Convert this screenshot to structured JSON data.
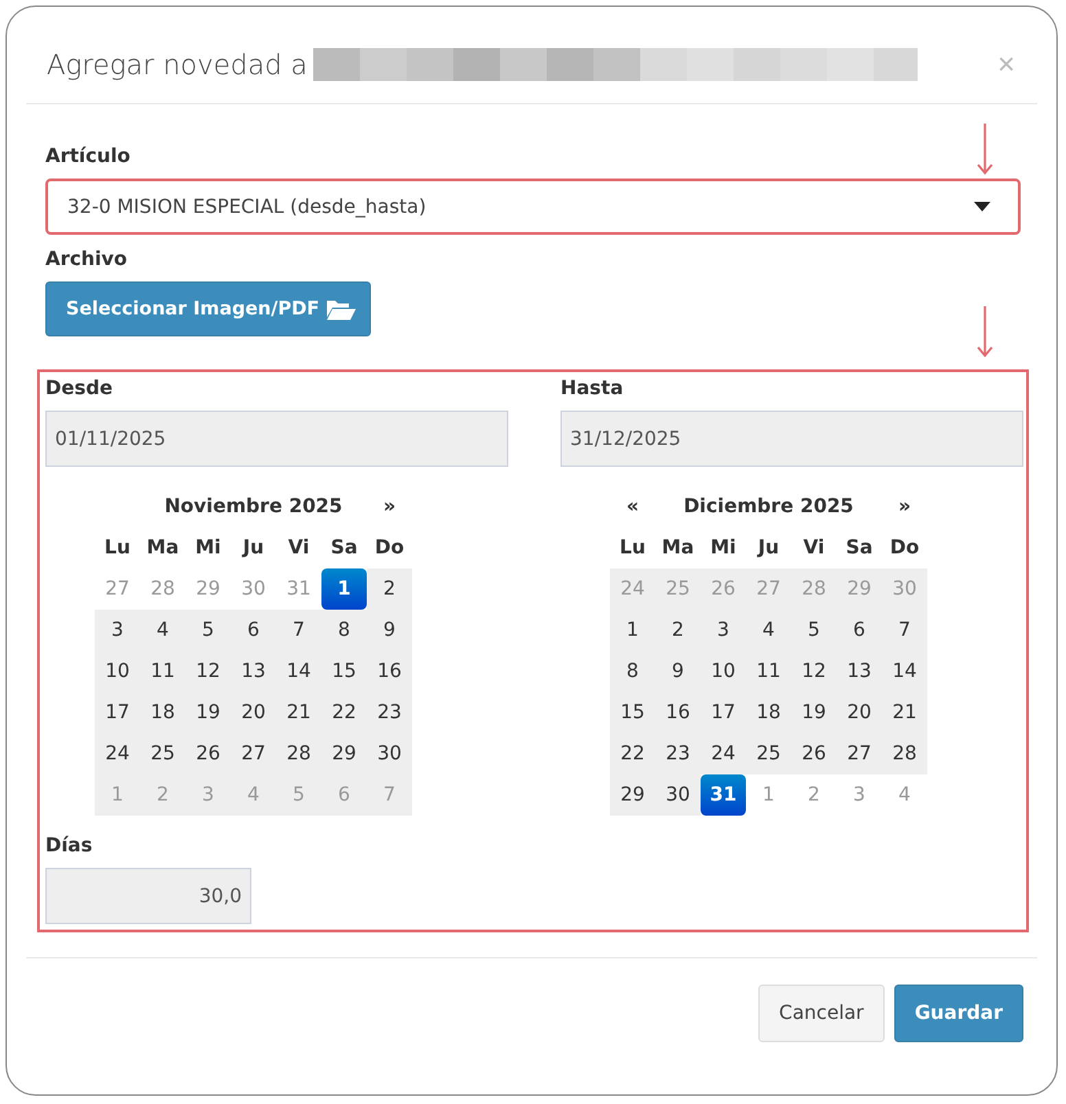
{
  "modal": {
    "title": "Agregar novedad a",
    "close": "×"
  },
  "article": {
    "label": "Artículo",
    "value": "32-0 MISION ESPECIAL (desde_hasta)",
    "highlighted": true
  },
  "file": {
    "label": "Archivo",
    "button": "Seleccionar Imagen/PDF"
  },
  "dates": {
    "highlighted": true,
    "from": {
      "label": "Desde",
      "value": "01/11/2025",
      "calendar": {
        "title": "Noviembre 2025",
        "next": "»",
        "weekdays": [
          "Lu",
          "Ma",
          "Mi",
          "Ju",
          "Vi",
          "Sa",
          "Do"
        ],
        "weeks": [
          [
            {
              "day": "27",
              "muted": true,
              "in_range": false,
              "selected": false
            },
            {
              "day": "28",
              "muted": true,
              "in_range": false,
              "selected": false
            },
            {
              "day": "29",
              "muted": true,
              "in_range": false,
              "selected": false
            },
            {
              "day": "30",
              "muted": true,
              "in_range": false,
              "selected": false
            },
            {
              "day": "31",
              "muted": true,
              "in_range": false,
              "selected": false
            },
            {
              "day": "1",
              "muted": false,
              "in_range": true,
              "selected": true
            },
            {
              "day": "2",
              "muted": false,
              "in_range": true,
              "selected": false
            }
          ],
          [
            {
              "day": "3",
              "muted": false,
              "in_range": true,
              "selected": false
            },
            {
              "day": "4",
              "muted": false,
              "in_range": true,
              "selected": false
            },
            {
              "day": "5",
              "muted": false,
              "in_range": true,
              "selected": false
            },
            {
              "day": "6",
              "muted": false,
              "in_range": true,
              "selected": false
            },
            {
              "day": "7",
              "muted": false,
              "in_range": true,
              "selected": false
            },
            {
              "day": "8",
              "muted": false,
              "in_range": true,
              "selected": false
            },
            {
              "day": "9",
              "muted": false,
              "in_range": true,
              "selected": false
            }
          ],
          [
            {
              "day": "10",
              "muted": false,
              "in_range": true,
              "selected": false
            },
            {
              "day": "11",
              "muted": false,
              "in_range": true,
              "selected": false
            },
            {
              "day": "12",
              "muted": false,
              "in_range": true,
              "selected": false
            },
            {
              "day": "13",
              "muted": false,
              "in_range": true,
              "selected": false
            },
            {
              "day": "14",
              "muted": false,
              "in_range": true,
              "selected": false
            },
            {
              "day": "15",
              "muted": false,
              "in_range": true,
              "selected": false
            },
            {
              "day": "16",
              "muted": false,
              "in_range": true,
              "selected": false
            }
          ],
          [
            {
              "day": "17",
              "muted": false,
              "in_range": true,
              "selected": false
            },
            {
              "day": "18",
              "muted": false,
              "in_range": true,
              "selected": false
            },
            {
              "day": "19",
              "muted": false,
              "in_range": true,
              "selected": false
            },
            {
              "day": "20",
              "muted": false,
              "in_range": true,
              "selected": false
            },
            {
              "day": "21",
              "muted": false,
              "in_range": true,
              "selected": false
            },
            {
              "day": "22",
              "muted": false,
              "in_range": true,
              "selected": false
            },
            {
              "day": "23",
              "muted": false,
              "in_range": true,
              "selected": false
            }
          ],
          [
            {
              "day": "24",
              "muted": false,
              "in_range": true,
              "selected": false
            },
            {
              "day": "25",
              "muted": false,
              "in_range": true,
              "selected": false
            },
            {
              "day": "26",
              "muted": false,
              "in_range": true,
              "selected": false
            },
            {
              "day": "27",
              "muted": false,
              "in_range": true,
              "selected": false
            },
            {
              "day": "28",
              "muted": false,
              "in_range": true,
              "selected": false
            },
            {
              "day": "29",
              "muted": false,
              "in_range": true,
              "selected": false
            },
            {
              "day": "30",
              "muted": false,
              "in_range": true,
              "selected": false
            }
          ],
          [
            {
              "day": "1",
              "muted": true,
              "in_range": true,
              "selected": false
            },
            {
              "day": "2",
              "muted": true,
              "in_range": true,
              "selected": false
            },
            {
              "day": "3",
              "muted": true,
              "in_range": true,
              "selected": false
            },
            {
              "day": "4",
              "muted": true,
              "in_range": true,
              "selected": false
            },
            {
              "day": "5",
              "muted": true,
              "in_range": true,
              "selected": false
            },
            {
              "day": "6",
              "muted": true,
              "in_range": true,
              "selected": false
            },
            {
              "day": "7",
              "muted": true,
              "in_range": true,
              "selected": false
            }
          ]
        ]
      }
    },
    "to": {
      "label": "Hasta",
      "value": "31/12/2025",
      "calendar": {
        "title": "Diciembre 2025",
        "prev": "«",
        "next": "»",
        "weekdays": [
          "Lu",
          "Ma",
          "Mi",
          "Ju",
          "Vi",
          "Sa",
          "Do"
        ],
        "weeks": [
          [
            {
              "day": "24",
              "muted": true,
              "in_range": true,
              "selected": false
            },
            {
              "day": "25",
              "muted": true,
              "in_range": true,
              "selected": false
            },
            {
              "day": "26",
              "muted": true,
              "in_range": true,
              "selected": false
            },
            {
              "day": "27",
              "muted": true,
              "in_range": true,
              "selected": false
            },
            {
              "day": "28",
              "muted": true,
              "in_range": true,
              "selected": false
            },
            {
              "day": "29",
              "muted": true,
              "in_range": true,
              "selected": false
            },
            {
              "day": "30",
              "muted": true,
              "in_range": true,
              "selected": false
            }
          ],
          [
            {
              "day": "1",
              "muted": false,
              "in_range": true,
              "selected": false
            },
            {
              "day": "2",
              "muted": false,
              "in_range": true,
              "selected": false
            },
            {
              "day": "3",
              "muted": false,
              "in_range": true,
              "selected": false
            },
            {
              "day": "4",
              "muted": false,
              "in_range": true,
              "selected": false
            },
            {
              "day": "5",
              "muted": false,
              "in_range": true,
              "selected": false
            },
            {
              "day": "6",
              "muted": false,
              "in_range": true,
              "selected": false
            },
            {
              "day": "7",
              "muted": false,
              "in_range": true,
              "selected": false
            }
          ],
          [
            {
              "day": "8",
              "muted": false,
              "in_range": true,
              "selected": false
            },
            {
              "day": "9",
              "muted": false,
              "in_range": true,
              "selected": false
            },
            {
              "day": "10",
              "muted": false,
              "in_range": true,
              "selected": false
            },
            {
              "day": "11",
              "muted": false,
              "in_range": true,
              "selected": false
            },
            {
              "day": "12",
              "muted": false,
              "in_range": true,
              "selected": false
            },
            {
              "day": "13",
              "muted": false,
              "in_range": true,
              "selected": false
            },
            {
              "day": "14",
              "muted": false,
              "in_range": true,
              "selected": false
            }
          ],
          [
            {
              "day": "15",
              "muted": false,
              "in_range": true,
              "selected": false
            },
            {
              "day": "16",
              "muted": false,
              "in_range": true,
              "selected": false
            },
            {
              "day": "17",
              "muted": false,
              "in_range": true,
              "selected": false
            },
            {
              "day": "18",
              "muted": false,
              "in_range": true,
              "selected": false
            },
            {
              "day": "19",
              "muted": false,
              "in_range": true,
              "selected": false
            },
            {
              "day": "20",
              "muted": false,
              "in_range": true,
              "selected": false
            },
            {
              "day": "21",
              "muted": false,
              "in_range": true,
              "selected": false
            }
          ],
          [
            {
              "day": "22",
              "muted": false,
              "in_range": true,
              "selected": false
            },
            {
              "day": "23",
              "muted": false,
              "in_range": true,
              "selected": false
            },
            {
              "day": "24",
              "muted": false,
              "in_range": true,
              "selected": false
            },
            {
              "day": "25",
              "muted": false,
              "in_range": true,
              "selected": false
            },
            {
              "day": "26",
              "muted": false,
              "in_range": true,
              "selected": false
            },
            {
              "day": "27",
              "muted": false,
              "in_range": true,
              "selected": false
            },
            {
              "day": "28",
              "muted": false,
              "in_range": true,
              "selected": false
            }
          ],
          [
            {
              "day": "29",
              "muted": false,
              "in_range": true,
              "selected": false
            },
            {
              "day": "30",
              "muted": false,
              "in_range": true,
              "selected": false
            },
            {
              "day": "31",
              "muted": false,
              "in_range": true,
              "selected": true
            },
            {
              "day": "1",
              "muted": true,
              "in_range": false,
              "selected": false
            },
            {
              "day": "2",
              "muted": true,
              "in_range": false,
              "selected": false
            },
            {
              "day": "3",
              "muted": true,
              "in_range": false,
              "selected": false
            },
            {
              "day": "4",
              "muted": true,
              "in_range": false,
              "selected": false
            }
          ]
        ]
      }
    },
    "days": {
      "label": "Días",
      "value": "30,0"
    }
  },
  "buttons": [
    {
      "label": "Cancelar",
      "kind": "default"
    },
    {
      "label": "Guardar",
      "kind": "primary"
    }
  ]
}
